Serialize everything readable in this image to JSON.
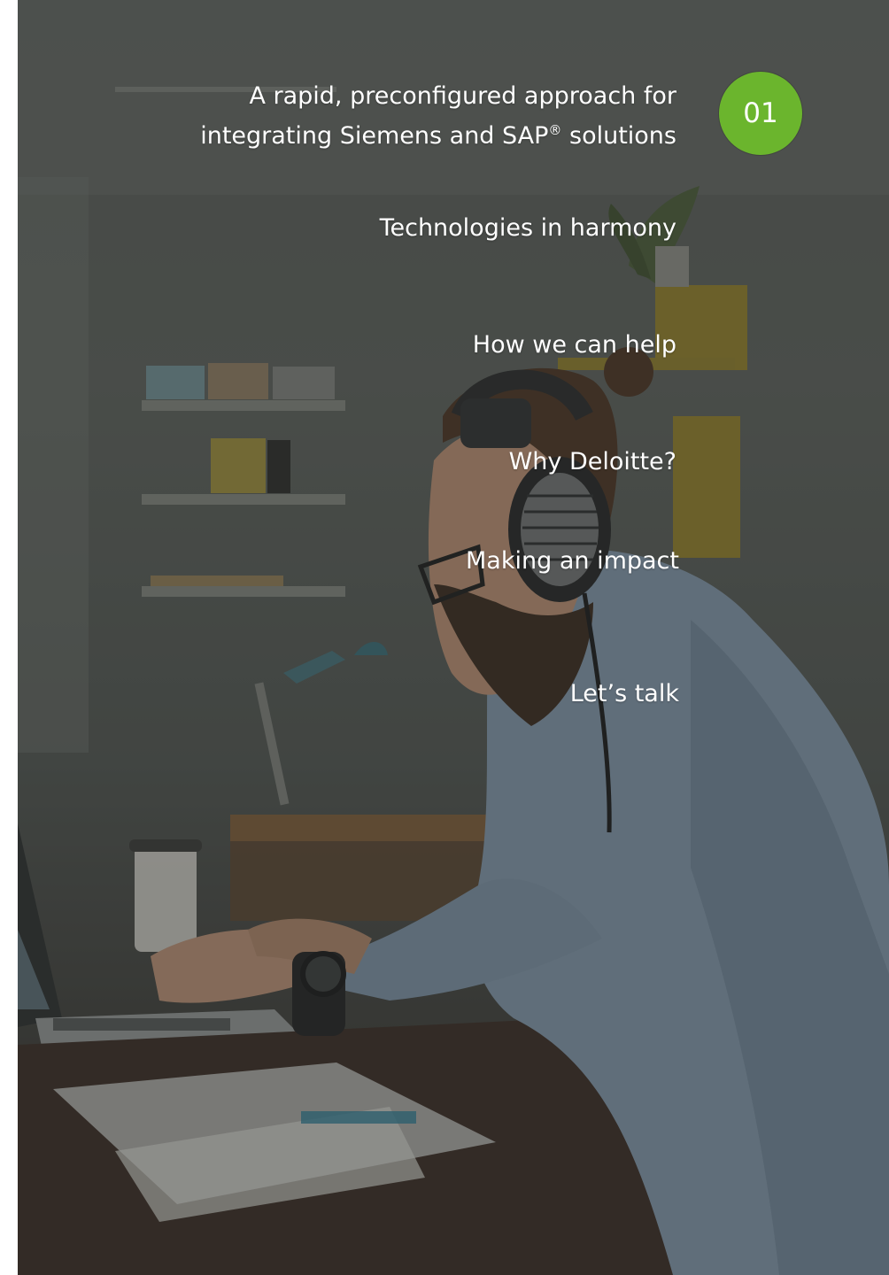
{
  "nav": {
    "items": [
      {
        "line1": "A rapid, preconfigured approach for",
        "line2_pre": "integrating Siemens and SAP",
        "line2_sup": "®",
        "line2_post": " solutions"
      },
      {
        "label": "Technologies in harmony"
      },
      {
        "label": "How we can help"
      },
      {
        "label": "Why Deloitte?"
      },
      {
        "label": "Making an impact"
      },
      {
        "label": "Let’s talk"
      }
    ]
  },
  "badge": {
    "number": "01"
  },
  "colors": {
    "accent": "#6bb52d",
    "text": "#ffffff"
  }
}
